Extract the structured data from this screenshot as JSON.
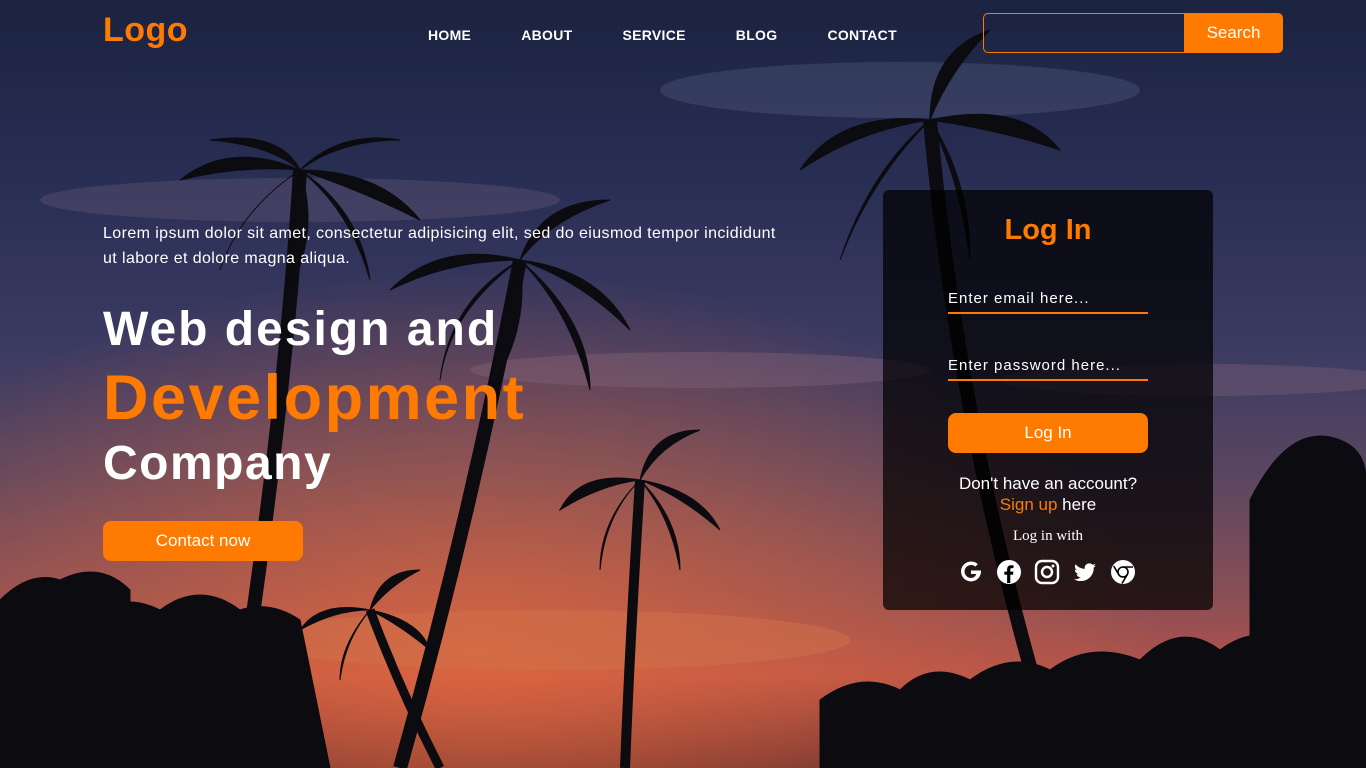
{
  "header": {
    "logo": "Logo",
    "nav": [
      "HOME",
      "ABOUT",
      "SERVICE",
      "BLOG",
      "CONTACT"
    ],
    "search": {
      "placeholder": "",
      "button_label": "Search"
    }
  },
  "hero": {
    "paragraph": "Lorem ipsum dolor sit amet, consectetur adipisicing elit, sed do eiusmod tempor incididunt ut labore et dolore magna aliqua.",
    "line1": "Web design and",
    "line2": "Development",
    "line3": "Company",
    "cta_label": "Contact now"
  },
  "login": {
    "title": "Log In",
    "email_placeholder": "Enter email here...",
    "password_placeholder": "Enter password here...",
    "button_label": "Log In",
    "account_prompt": "Don't have an account?",
    "signup_link": "Sign up",
    "signup_suffix": " here",
    "login_with": "Log in with",
    "social_icons": [
      "google-icon",
      "facebook-icon",
      "instagram-icon",
      "twitter-icon",
      "chrome-icon"
    ]
  },
  "colors": {
    "accent": "#ff7a00",
    "text": "#ffffff",
    "card_bg": "rgba(0,0,0,0.72)"
  }
}
